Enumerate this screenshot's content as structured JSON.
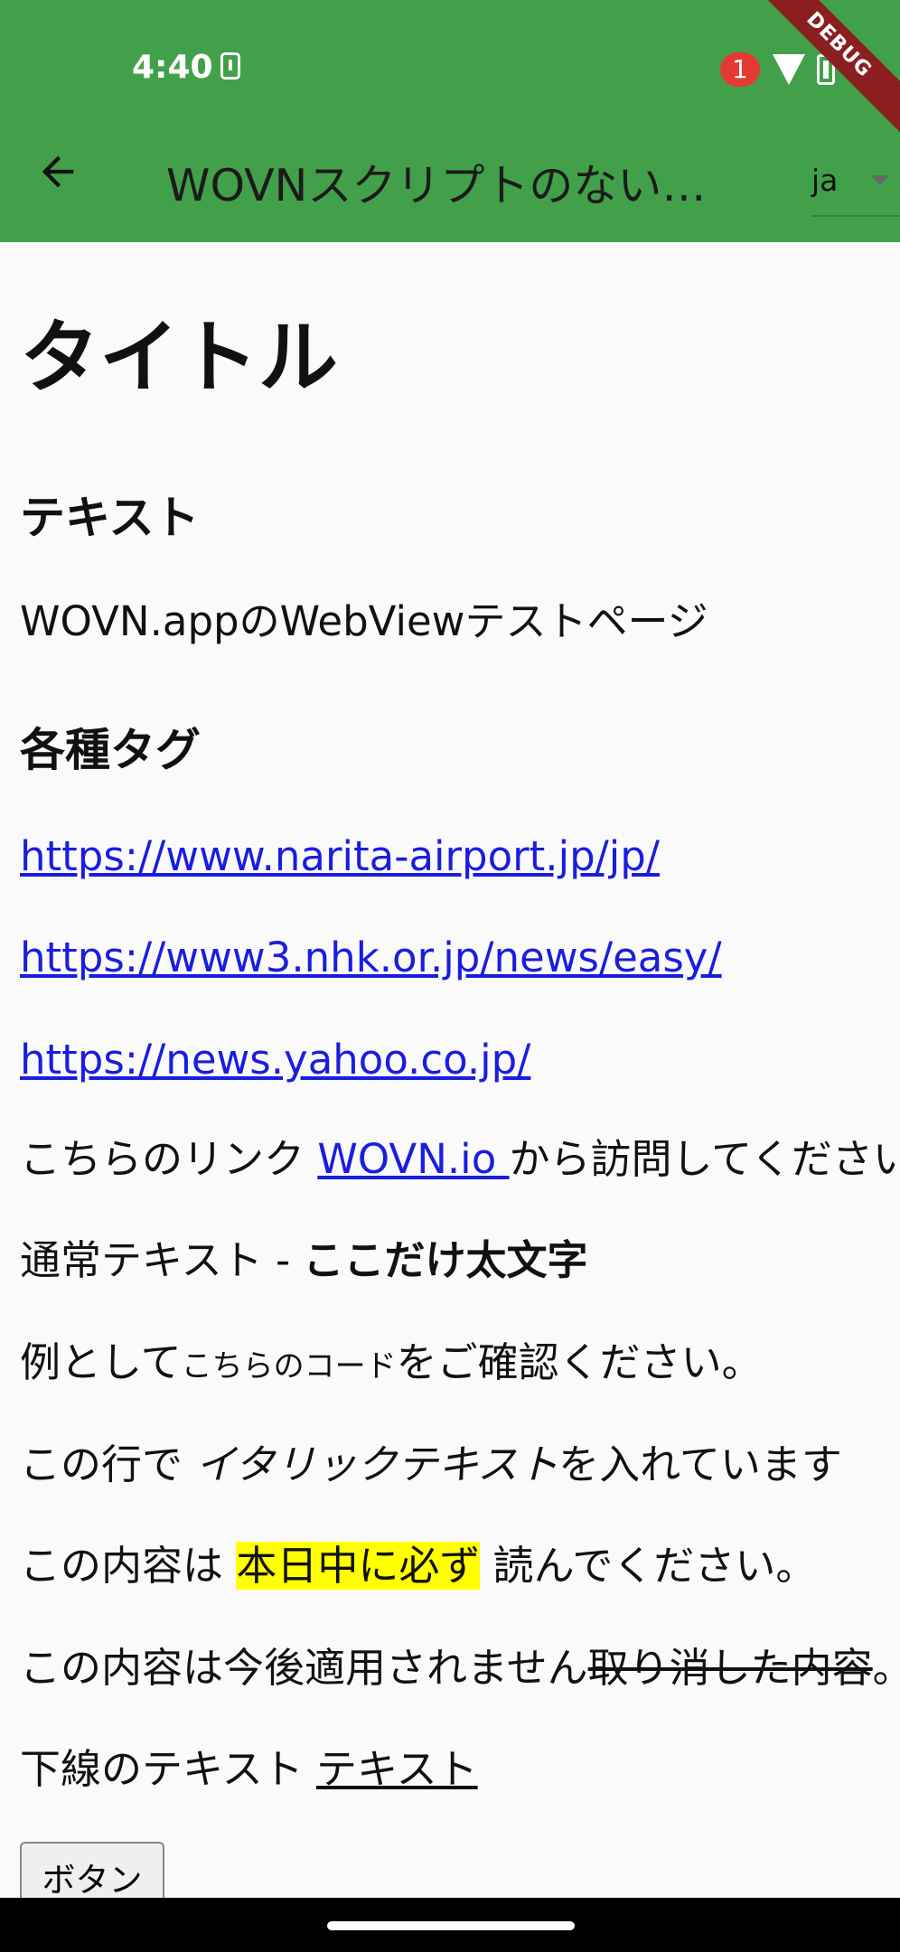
{
  "status_bar": {
    "time": "4:40",
    "notification_count": "1"
  },
  "debug_label": "DEBUG",
  "app_bar": {
    "title": "WOVNスクリプトのない…",
    "language": "ja"
  },
  "page": {
    "title": "タイトル",
    "section_text": "テキスト",
    "intro": "WOVN.appのWebViewテストページ",
    "section_tags": "各種タグ",
    "links": [
      "https://www.narita-airport.jp/jp/",
      "https://www3.nhk.or.jp/news/easy/",
      "https://news.yahoo.co.jp/"
    ],
    "visit_prefix": "こちらのリンク ",
    "visit_link": "WOVN.io ",
    "visit_suffix": "から訪問してください",
    "bold_prefix": "通常テキスト - ",
    "bold_text": "ここだけ太文字",
    "code_prefix": "例として",
    "code_text": "こちらのコード",
    "code_suffix": "をご確認ください。",
    "italic_prefix": "この行で ",
    "italic_text": "イタリックテキスト",
    "italic_suffix": "を入れています",
    "mark_prefix": "この内容は ",
    "mark_text": "本日中に必ず",
    "mark_suffix": " 読んでください。",
    "strike_prefix": "この内容は今後適用されません",
    "strike_text": "取り消した内容",
    "strike_suffix": "。",
    "underline_prefix": "下線のテキスト ",
    "underline_text": "テキスト",
    "button_label": "ボタン"
  }
}
